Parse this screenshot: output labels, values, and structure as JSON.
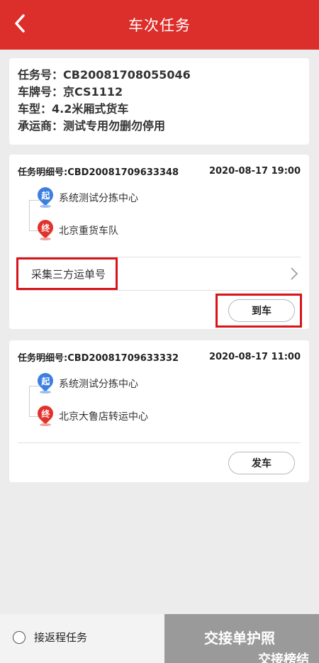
{
  "header": {
    "title": "车次任务"
  },
  "info": {
    "task_no": "任务号：CB20081708055046",
    "plate": "车牌号：京CS1112",
    "vehicle_type": "车型：4.2米厢式货车",
    "carrier": "承运商：测试专用勿删勿停用"
  },
  "tasks": [
    {
      "detail_no": "任务明细号:CBD20081709633348",
      "time": "2020-08-17 19:00",
      "start_badge": "起",
      "start": "系统测试分拣中心",
      "end_badge": "终",
      "end": "北京重货车队",
      "collect_label": "采集三方运单号",
      "action_label": "到车"
    },
    {
      "detail_no": "任务明细号:CBD20081709633332",
      "time": "2020-08-17 11:00",
      "start_badge": "起",
      "start": "系统测试分拣中心",
      "end_badge": "终",
      "end": "北京大鲁店转运中心",
      "action_label": "发车"
    }
  ],
  "bottom": {
    "return_task_label": "接返程任务",
    "handover_label_1": "交接单护照",
    "handover_label_2": "交接榜结"
  },
  "colors": {
    "brand": "#dc2e2a",
    "highlight": "#d8141a"
  }
}
